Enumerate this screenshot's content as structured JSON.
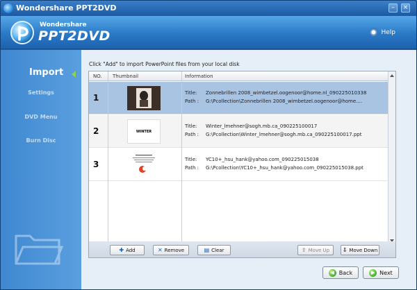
{
  "window": {
    "title": "Wondershare PPT2DVD"
  },
  "banner": {
    "brand_small": "Wondershare",
    "brand_big": "PPT2DVD",
    "help_label": "Help"
  },
  "sidebar": {
    "items": [
      {
        "label": "Import",
        "active": true
      },
      {
        "label": "Settings",
        "active": false
      },
      {
        "label": "DVD Menu",
        "active": false
      },
      {
        "label": "Burn Disc",
        "active": false
      }
    ]
  },
  "main": {
    "hint": "Click \"Add\" to import PowerPoint files from your local disk",
    "columns": [
      "NO.",
      "Thumbnail",
      "Information"
    ],
    "info_labels": {
      "title": "Title:",
      "path": "Path :"
    },
    "rows": [
      {
        "no": "1",
        "title": "Zonnebrillen 2008_wimbetzel.oogenoor@home.nl_090225010338",
        "path": "G:\\Pcollection\\Zonnebrillen 2008_wimbetzel.oogenoor@home....",
        "thumb_text": ""
      },
      {
        "no": "2",
        "title": "Winter_lmehner@sogh.mb.ca_090225100017",
        "path": "G:\\Pcollection\\Winter_lmehner@sogh.mb.ca_090225100017.ppt",
        "thumb_text": "WINTER"
      },
      {
        "no": "3",
        "title": "YC10+_hsu_hank@yahoo.com_090225015038",
        "path": "G:\\Pcollection\\YC10+_hsu_hank@yahoo.com_090225015038.ppt",
        "thumb_text": "ByteDance"
      }
    ]
  },
  "buttons": {
    "add": "Add",
    "remove": "Remove",
    "clear": "Clear",
    "move_up": "Move Up",
    "move_down": "Move Down",
    "back": "Back",
    "next": "Next"
  }
}
